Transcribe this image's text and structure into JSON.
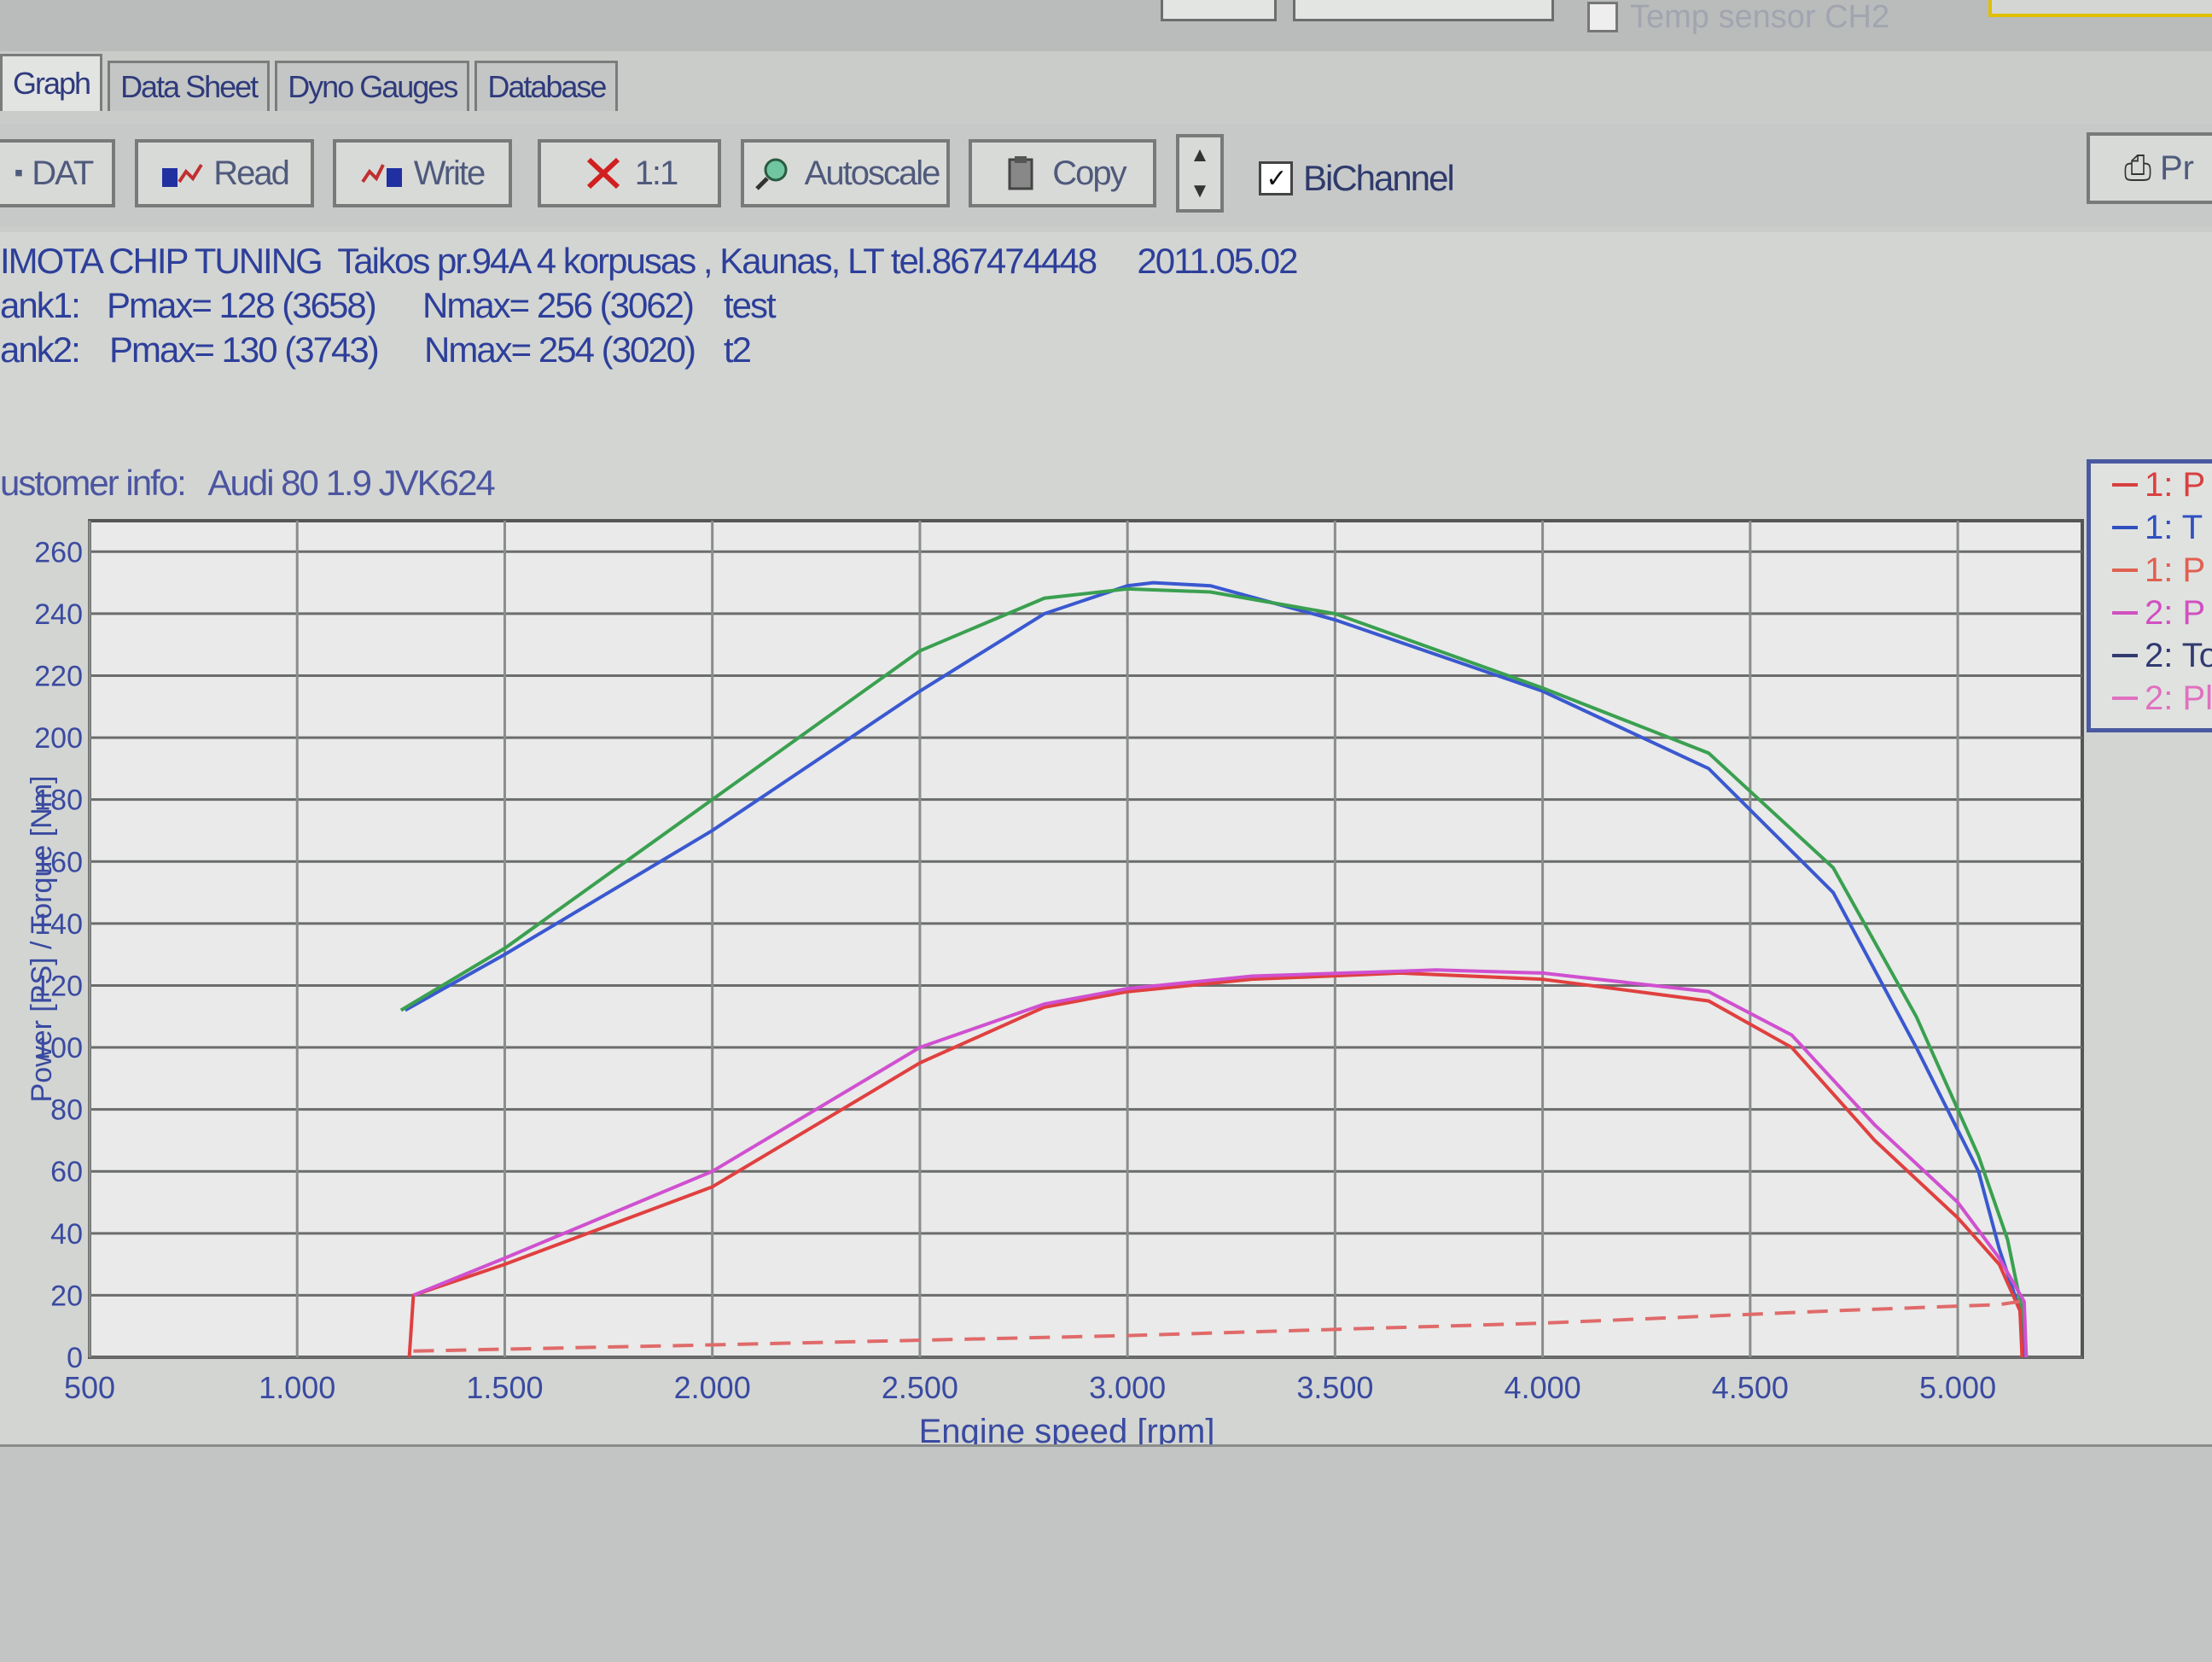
{
  "topbar": {
    "temp_sensor_label": "Temp sensor CH2"
  },
  "tabs": [
    {
      "label": "Graph",
      "active": true
    },
    {
      "label": "Data Sheet",
      "active": false
    },
    {
      "label": "Dyno Gauges",
      "active": false
    },
    {
      "label": "Database",
      "active": false
    }
  ],
  "toolbar": {
    "dat_label": "DAT",
    "read_label": "Read",
    "write_label": "Write",
    "scale_label": "1:1",
    "autoscale_label": "Autoscale",
    "copy_label": "Copy",
    "bichannel_label": "BiChannel",
    "bichannel_checked": true,
    "print_label": "Pr"
  },
  "header": {
    "company_line": "IMOTA CHIP TUNING  Taikos pr.94A 4 korpusas , Kaunas, LT tel.867474448     2011.05.02",
    "run1": {
      "prefix": "ank1:",
      "pmax": "Pmax= 128 (3658)",
      "nmax": "Nmax= 256 (3062)",
      "name": "test"
    },
    "run2": {
      "prefix": "ank2:",
      "pmax": "Pmax= 130 (3743)",
      "nmax": "Nmax= 254 (3020)",
      "name": "t2"
    },
    "customer_info": "ustomer info:   Audi 80 1.9 JVK624"
  },
  "legend": [
    {
      "label": "1: P",
      "color": "#d84040"
    },
    {
      "label": "1: T",
      "color": "#3050c0"
    },
    {
      "label": "1: P",
      "color": "#e06050"
    },
    {
      "label": "2: P",
      "color": "#d050c0"
    },
    {
      "label": "2: To",
      "color": "#303a70"
    },
    {
      "label": "2: Pl",
      "color": "#e070c0"
    }
  ],
  "chart_data": {
    "type": "line",
    "xlabel": "Engine speed [rpm]",
    "ylabel": "Power [PS] / Torque [Nm]",
    "xlim": [
      500,
      5300
    ],
    "ylim": [
      0,
      260
    ],
    "x_ticks": [
      500,
      1000,
      1500,
      2000,
      2500,
      3000,
      3500,
      4000,
      4500,
      5000
    ],
    "x_tick_labels": [
      "500",
      "1.000",
      "1.500",
      "2.000",
      "2.500",
      "3.000",
      "3.500",
      "4.000",
      "4.500",
      "5.000"
    ],
    "y_ticks": [
      0,
      20,
      40,
      60,
      80,
      100,
      120,
      140,
      160,
      180,
      200,
      220,
      240,
      260
    ],
    "y_tick_labels": [
      "0",
      "20",
      "40",
      "60",
      "80",
      "100",
      "120",
      "140",
      "160",
      "180",
      "200",
      "220",
      "240",
      "260"
    ],
    "grid": true,
    "series": [
      {
        "color": "#3a58d0",
        "points": [
          [
            1260,
            112
          ],
          [
            1500,
            130
          ],
          [
            2000,
            170
          ],
          [
            2500,
            215
          ],
          [
            2800,
            240
          ],
          [
            3000,
            249
          ],
          [
            3062,
            250
          ],
          [
            3200,
            249
          ],
          [
            3500,
            238
          ],
          [
            4000,
            215
          ],
          [
            4400,
            190
          ],
          [
            4700,
            150
          ],
          [
            4900,
            100
          ],
          [
            5050,
            60
          ],
          [
            5100,
            35
          ],
          [
            5150,
            15
          ],
          [
            5160,
            0
          ]
        ]
      },
      {
        "color": "#3aa050",
        "points": [
          [
            1250,
            112
          ],
          [
            1500,
            132
          ],
          [
            2000,
            180
          ],
          [
            2500,
            228
          ],
          [
            2800,
            245
          ],
          [
            3000,
            248
          ],
          [
            3200,
            247
          ],
          [
            3500,
            240
          ],
          [
            4000,
            216
          ],
          [
            4400,
            195
          ],
          [
            4700,
            158
          ],
          [
            4900,
            110
          ],
          [
            5050,
            65
          ],
          [
            5120,
            38
          ],
          [
            5160,
            12
          ],
          [
            5165,
            0
          ]
        ]
      },
      {
        "color": "#e04040",
        "points": [
          [
            1270,
            0
          ],
          [
            1280,
            20
          ],
          [
            1500,
            30
          ],
          [
            2000,
            55
          ],
          [
            2500,
            95
          ],
          [
            2800,
            113
          ],
          [
            3000,
            118
          ],
          [
            3300,
            122
          ],
          [
            3658,
            124
          ],
          [
            4000,
            122
          ],
          [
            4400,
            115
          ],
          [
            4600,
            100
          ],
          [
            4800,
            70
          ],
          [
            5000,
            45
          ],
          [
            5100,
            30
          ],
          [
            5150,
            15
          ],
          [
            5155,
            0
          ]
        ]
      },
      {
        "color": "#d050d0",
        "points": [
          [
            1280,
            20
          ],
          [
            1500,
            32
          ],
          [
            2000,
            60
          ],
          [
            2500,
            100
          ],
          [
            2800,
            114
          ],
          [
            3000,
            119
          ],
          [
            3300,
            123
          ],
          [
            3743,
            125
          ],
          [
            4000,
            124
          ],
          [
            4400,
            118
          ],
          [
            4600,
            104
          ],
          [
            4800,
            75
          ],
          [
            5000,
            50
          ],
          [
            5100,
            32
          ],
          [
            5160,
            18
          ],
          [
            5165,
            0
          ]
        ]
      },
      {
        "color": "#e06a6a",
        "dashed": true,
        "points": [
          [
            1280,
            2
          ],
          [
            2000,
            4
          ],
          [
            3000,
            7
          ],
          [
            4000,
            11
          ],
          [
            4700,
            15
          ],
          [
            5100,
            17
          ],
          [
            5150,
            18
          ]
        ]
      }
    ]
  }
}
